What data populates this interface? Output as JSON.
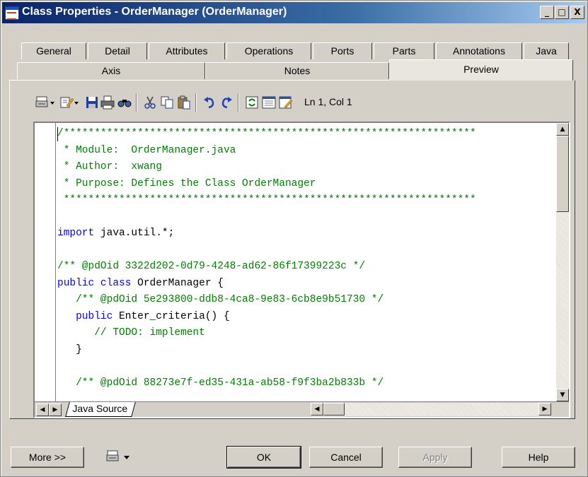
{
  "window": {
    "title": "Class Properties - OrderManager (OrderManager)",
    "minimize": "_",
    "maximize": "□",
    "close": "X"
  },
  "tabs_row1": [
    "General",
    "Detail",
    "Attributes",
    "Operations",
    "Ports",
    "Parts",
    "Annotations",
    "Java"
  ],
  "tabs_row2": [
    "Axis",
    "Notes",
    "Preview"
  ],
  "active_tab": "Preview",
  "toolbar": {
    "icons": [
      "print-icon",
      "edit-icon",
      "save-icon",
      "printer-icon",
      "find-icon",
      "cut-icon",
      "copy-icon",
      "paste-icon",
      "undo-icon",
      "redo-icon",
      "refresh-icon",
      "properties-icon",
      "edit-template-icon"
    ],
    "position": "Ln 1, Col 1"
  },
  "code_lines": [
    {
      "t": "/*******************************************************************",
      "c": "cm"
    },
    {
      "t": " * Module:  OrderManager.java",
      "c": "cm"
    },
    {
      "t": " * Author:  xwang",
      "c": "cm"
    },
    {
      "t": " * Purpose: Defines the Class OrderManager",
      "c": "cm"
    },
    {
      "t": " *******************************************************************",
      "c": "cm"
    },
    {
      "t": "",
      "c": "pl"
    },
    {
      "parts": [
        {
          "t": "import",
          "c": "kw"
        },
        {
          "t": " java.util.*;",
          "c": "pl"
        }
      ]
    },
    {
      "t": "",
      "c": "pl"
    },
    {
      "t": "/** @pdOid 3322d202-0d79-4248-ad62-86f17399223c */",
      "c": "cm"
    },
    {
      "parts": [
        {
          "t": "public class",
          "c": "kw"
        },
        {
          "t": " OrderManager {",
          "c": "pl"
        }
      ]
    },
    {
      "t": "   /** @pdOid 5e293800-ddb8-4ca8-9e83-6cb8e9b51730 */",
      "c": "cm"
    },
    {
      "parts": [
        {
          "t": "   ",
          "c": "pl"
        },
        {
          "t": "public",
          "c": "kw"
        },
        {
          "t": " Enter_criteria() {",
          "c": "pl"
        }
      ]
    },
    {
      "t": "      // TODO: implement",
      "c": "cm"
    },
    {
      "t": "   }",
      "c": "pl"
    },
    {
      "t": "",
      "c": "pl"
    },
    {
      "t": "   /** @pdOid 88273e7f-ed35-431a-ab58-f9f3ba2b833b */",
      "c": "cm"
    },
    {
      "t": "",
      "c": "pl"
    }
  ],
  "doc_tab": "Java Source",
  "buttons": {
    "more": "More >>",
    "ok": "OK",
    "cancel": "Cancel",
    "apply": "Apply",
    "help": "Help"
  }
}
